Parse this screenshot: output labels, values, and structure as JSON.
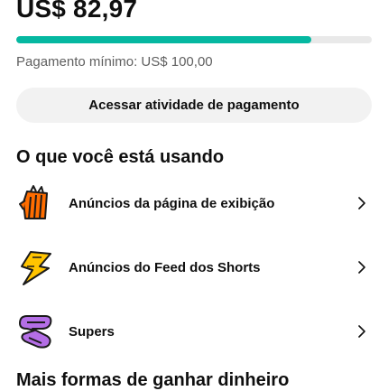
{
  "balance": {
    "amount": "US$ 82,97",
    "progress_fraction": 0.83,
    "minimum_payment_label": "Pagamento mínimo: US$ 100,00"
  },
  "actions": {
    "payment_activity_label": "Acessar atividade de pagamento"
  },
  "usage": {
    "title": "O que você está usando",
    "items": [
      {
        "label": "Anúncios da página de exibição",
        "icon": "orange-ads-icon",
        "color": "#ff6d00"
      },
      {
        "label": "Anúncios do Feed dos Shorts",
        "icon": "lightning-bolt-icon",
        "color": "#ffc400"
      },
      {
        "label": "Supers",
        "icon": "purple-supers-icon",
        "color": "#b46ee6"
      }
    ]
  },
  "more": {
    "title": "Mais formas de ganhar dinheiro"
  },
  "colors": {
    "progress": "#05b8a1",
    "track": "#e9e9e9"
  }
}
